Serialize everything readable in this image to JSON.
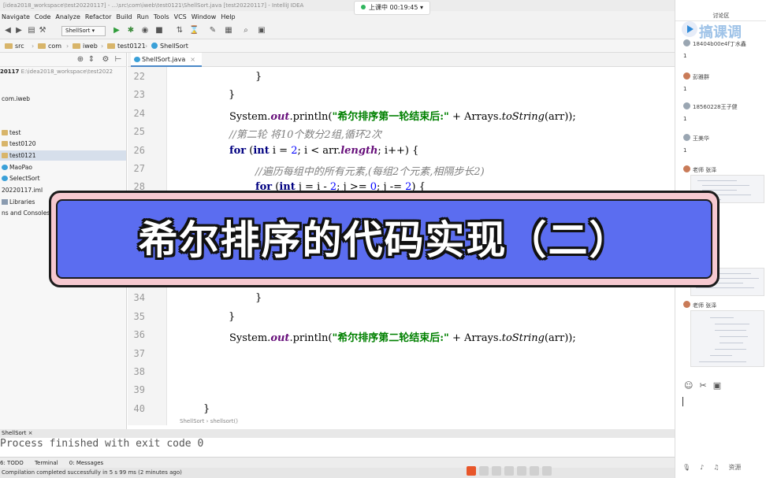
{
  "ide": {
    "title": "[idea2018_workspace\\test20220117] - ...\\src\\com\\iweb\\test0121\\ShellSort.java [test20220117] - IntelliJ IDEA",
    "menu": [
      "Navigate",
      "Code",
      "Analyze",
      "Refactor",
      "Build",
      "Run",
      "Tools",
      "VCS",
      "Window",
      "Help"
    ],
    "run_config": "ShellSort",
    "breadcrumbs": [
      "src",
      "com",
      "iweb",
      "test0121",
      "ShellSort"
    ],
    "project_root": {
      "name": "20117",
      "path": "E:\\idea2018_workspace\\test2022"
    },
    "tree": [
      "com.iweb",
      "test",
      "test0120",
      "test0121",
      "MaoPao",
      "SelectSort",
      "20220117.iml",
      "Libraries",
      "ns and Consoles"
    ],
    "tab": "ShellSort.java",
    "editor_breadcrumb": [
      "ShellSort",
      "shellsort()"
    ],
    "line_numbers": [
      "22",
      "23",
      "24",
      "25",
      "26",
      "27",
      "28",
      "34",
      "35",
      "36",
      "37",
      "38",
      "39",
      "40"
    ],
    "code": {
      "l24_a": "System.",
      "l24_out": "out",
      "l24_b": ".println(",
      "l24_str": "\"希尔排序第一轮结束后:\"",
      "l24_c": " + Arrays.",
      "l24_m": "toString",
      "l24_d": "(arr));",
      "l25": "//第二轮 将10个数分2组,循环2次",
      "l26_kw1": "for",
      "l26_a": " (",
      "l26_kw2": "int",
      "l26_b": " i = ",
      "l26_n": "2",
      "l26_c": "; i < arr.",
      "l26_f": "length",
      "l26_d": "; i++) {",
      "l27": "//遍历每组中的所有元素,(每组2个元素,相隔步长2)",
      "l28_kw1": "for",
      "l28_a": " (",
      "l28_kw2": "int",
      "l28_b": " j = i - ",
      "l28_n": "2",
      "l28_c": "; j >= ",
      "l28_n2": "0",
      "l28_d": "; j -= ",
      "l28_n3": "2",
      "l28_e": ") {",
      "l36_str": "\"希尔排序第二轮结束后:\"",
      "brace": "}"
    },
    "bottom_tab": "ShellSort",
    "console": "Process finished with exit code 0",
    "tool_tabs": [
      "6: TODO",
      "Terminal",
      "0: Messages"
    ],
    "status": "Compilation completed successfully in 5 s 99 ms (2 minutes ago)"
  },
  "timer": {
    "label": "上课中 00:19:45"
  },
  "banner": {
    "title": "希尔排序的代码实现（二）"
  },
  "discussion": {
    "header": "讨论区",
    "watermark": "搞课调",
    "messages": [
      {
        "name": "18404b00e4f丁水鑫",
        "count": "1"
      },
      {
        "name": "彭雅群",
        "count": "1"
      },
      {
        "name": "18560228王子健",
        "count": "1"
      },
      {
        "name": "王美华",
        "count": "1"
      },
      {
        "name": "老师 张泽"
      },
      {
        "name": "老师 张泽"
      }
    ],
    "bottom": "资源"
  },
  "colors": {
    "banner_fill": "#5b6df0",
    "banner_frame": "#f6c9d0",
    "keyword": "#000080",
    "string": "#008000"
  }
}
